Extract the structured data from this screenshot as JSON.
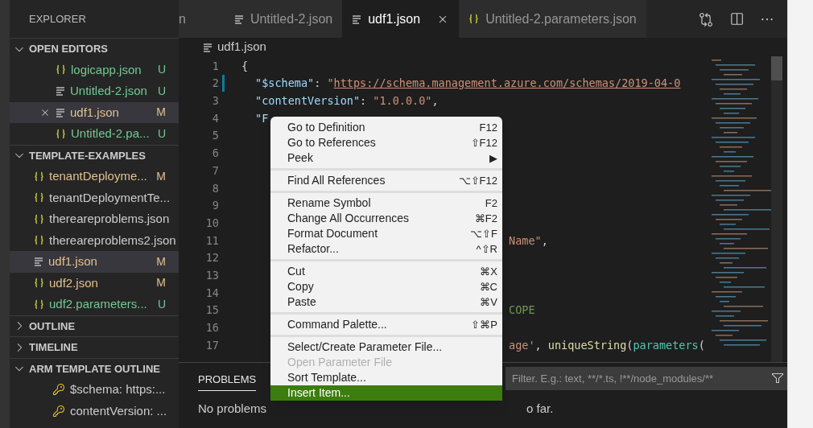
{
  "sidebar": {
    "title": "EXPLORER",
    "sections": [
      {
        "title": "OPEN EDITORS",
        "expanded": true,
        "items": [
          {
            "kind": "braces",
            "name": "logicapp.json",
            "status": "U",
            "selected": false
          },
          {
            "kind": "lines",
            "name": "Untitled-2.json",
            "status": "U",
            "selected": false
          },
          {
            "kind": "lines",
            "name": "udf1.json",
            "status": "M",
            "selected": true,
            "closable": true
          },
          {
            "kind": "braces",
            "name": "Untitled-2.pa...",
            "status": "U",
            "selected": false
          }
        ]
      },
      {
        "title": "TEMPLATE-EXAMPLES",
        "expanded": true,
        "items": [
          {
            "kind": "braces",
            "name": "tenantDeployme...",
            "status": "M",
            "selected": false
          },
          {
            "kind": "braces",
            "name": "tenantDeploymentTe...",
            "selected": false
          },
          {
            "kind": "braces",
            "name": "thereareproblems.json",
            "selected": false
          },
          {
            "kind": "braces",
            "name": "thereareproblems2.json",
            "selected": false
          },
          {
            "kind": "lines",
            "name": "udf1.json",
            "status": "M",
            "selected": true
          },
          {
            "kind": "braces",
            "name": "udf2.json",
            "status": "M",
            "selected": false
          },
          {
            "kind": "braces",
            "name": "udf2.parameters...",
            "status": "U",
            "selected": false
          }
        ]
      },
      {
        "title": "OUTLINE",
        "expanded": false
      },
      {
        "title": "TIMELINE",
        "expanded": false
      },
      {
        "title": "ARM TEMPLATE OUTLINE",
        "expanded": true,
        "items": [
          {
            "kind": "key",
            "name": "$schema: https:...",
            "selected": false
          },
          {
            "kind": "key",
            "name": "contentVersion: ...",
            "selected": false
          }
        ]
      }
    ]
  },
  "tabs": [
    {
      "kind": "none",
      "label": "n",
      "selected": false
    },
    {
      "kind": "lines",
      "label": "Untitled-2.json",
      "selected": false
    },
    {
      "kind": "lines",
      "label": "udf1.json",
      "selected": true
    },
    {
      "kind": "braces",
      "label": "Untitled-2.parameters.json",
      "selected": false
    }
  ],
  "breadcrumb": "udf1.json",
  "code_lines": [
    {
      "number": "1",
      "tokens": [
        {
          "kind": "punct",
          "text": "{"
        }
      ]
    },
    {
      "number": "2",
      "indented": true,
      "modified": true,
      "tokens": [
        {
          "kind": "key",
          "text": "\"$schema\""
        },
        {
          "kind": "punct",
          "text": ": "
        },
        {
          "kind": "str",
          "text": "\""
        },
        {
          "kind": "url",
          "text": "https://schema.management.azure.com/schemas/2019-04-0"
        }
      ]
    },
    {
      "number": "3",
      "indented": true,
      "tokens": [
        {
          "kind": "key",
          "text": "\"contentVersion\""
        },
        {
          "kind": "punct",
          "text": ": "
        },
        {
          "kind": "str",
          "text": "\"1.0.0.0\""
        },
        {
          "kind": "punct",
          "text": ","
        }
      ]
    },
    {
      "number": "4",
      "indented": true,
      "tokens": [
        {
          "kind": "key",
          "text": "\"F"
        }
      ]
    },
    {
      "number": "5"
    },
    {
      "number": "6"
    },
    {
      "number": "7"
    },
    {
      "number": "8"
    },
    {
      "number": "9"
    },
    {
      "number": "10"
    },
    {
      "number": "11",
      "kind": "covered",
      "tokens": [
        {
          "kind": "str",
          "text": "Name\""
        },
        {
          "kind": "punct",
          "text": ","
        }
      ]
    },
    {
      "number": "12"
    },
    {
      "number": "13"
    },
    {
      "number": "14"
    },
    {
      "number": "15",
      "kind": "covered",
      "tokens": [
        {
          "kind": "const",
          "text": "COPE"
        }
      ]
    },
    {
      "number": "16"
    },
    {
      "number": "17",
      "kind": "covered",
      "tokens": [
        {
          "kind": "str",
          "text": "age'"
        },
        {
          "kind": "punct",
          "text": ", "
        },
        {
          "kind": "func",
          "text": "uniqueString"
        },
        {
          "kind": "punct",
          "text": "("
        },
        {
          "kind": "param",
          "text": "parameters"
        },
        {
          "kind": "punct",
          "text": "("
        }
      ]
    }
  ],
  "context_menu": [
    [
      {
        "label": "Go to Definition",
        "shortcut": "F12",
        "selected": false
      },
      {
        "label": "Go to References",
        "shortcut": "⇧F12",
        "selected": false
      },
      {
        "label": "Peek",
        "shortcut": "▶",
        "selected": false
      }
    ],
    [
      {
        "label": "Find All References",
        "shortcut": "⌥⇧F12",
        "selected": false
      }
    ],
    [
      {
        "label": "Rename Symbol",
        "shortcut": "F2",
        "selected": false
      },
      {
        "label": "Change All Occurrences",
        "shortcut": "⌘F2",
        "selected": false
      },
      {
        "label": "Format Document",
        "shortcut": "⌥⇧F",
        "selected": false
      },
      {
        "label": "Refactor...",
        "shortcut": "^⇧R",
        "selected": false
      }
    ],
    [
      {
        "label": "Cut",
        "shortcut": "⌘X",
        "selected": false
      },
      {
        "label": "Copy",
        "shortcut": "⌘C",
        "selected": false
      },
      {
        "label": "Paste",
        "shortcut": "⌘V",
        "selected": false
      }
    ],
    [
      {
        "label": "Command Palette...",
        "shortcut": "⇧⌘P",
        "selected": false
      }
    ],
    [
      {
        "label": "Select/Create Parameter File...",
        "selected": false
      },
      {
        "label": "Open Parameter File",
        "disabled": true,
        "selected": false
      },
      {
        "label": "Sort Template...",
        "selected": false
      },
      {
        "label": "Insert Item...",
        "selected": true
      }
    ]
  ],
  "panel": {
    "tab": {
      "label": "PROBLEMS",
      "selected": true
    },
    "message_start": "No problems",
    "message_end": "o far.",
    "filter": {
      "placeholder": "Filter. E.g.: text, **/*.ts, !**/node_modules/**"
    }
  }
}
